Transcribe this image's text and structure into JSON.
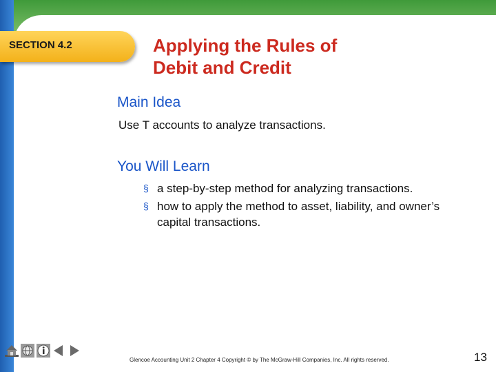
{
  "section": {
    "label": "SECTION 4.2"
  },
  "title": {
    "line1": "Applying the Rules of",
    "line2": "Debit and Credit"
  },
  "main_idea": {
    "heading": "Main Idea",
    "text": "Use T accounts to analyze transactions."
  },
  "you_will_learn": {
    "heading": "You Will Learn",
    "marker": "§",
    "bullets": [
      "a step-by-step method for analyzing transactions.",
      "how to apply the method to asset, liability, and owner’s capital transactions."
    ]
  },
  "footer": {
    "text": "Glencoe Accounting  Unit 2  Chapter 4   Copyright © by The McGraw-Hill Companies, Inc. All rights reserved.",
    "page_number": "13"
  },
  "nav": [
    "home-icon",
    "web-globe-icon",
    "info-icon",
    "previous-arrow-icon",
    "next-arrow-icon"
  ],
  "colors": {
    "title": "#cc2a1f",
    "heading": "#1a55c8",
    "section_tab": "#f3b11a",
    "top_band": "#3f9a3a",
    "left_band": "#1f5fb0"
  }
}
